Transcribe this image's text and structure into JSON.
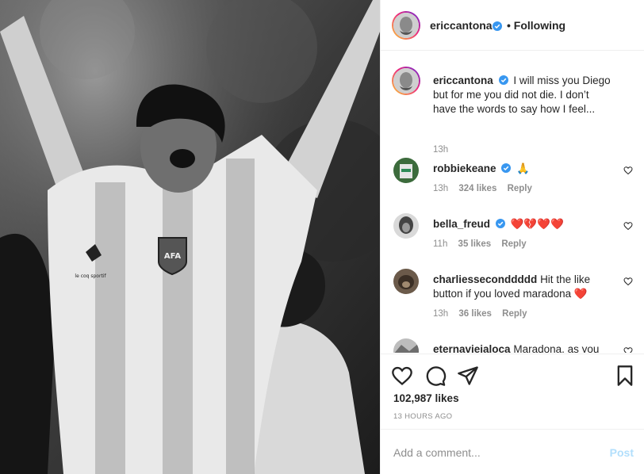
{
  "post": {
    "author": "ericcantona",
    "follow_status": "• Following",
    "caption": "I will miss you Diego but for me you did not die. I don’t have the words to say how I feel...",
    "caption_time": "13h",
    "likes": "102,987 likes",
    "time_ago": "13 HOURS AGO"
  },
  "photo": {
    "badge_text": "AFA",
    "brand_text": "le coq sportif"
  },
  "comments": [
    {
      "user": "robbiekeane",
      "text": "🙏",
      "time": "13h",
      "likes": "324 likes",
      "reply": "Reply"
    },
    {
      "user": "bella_freud",
      "text": "❤️💔❤️❤️",
      "time": "11h",
      "likes": "35 likes",
      "reply": "Reply"
    },
    {
      "user": "charliesseconddddd",
      "text": "Hit the like button if you loved maradona ❤️",
      "time": "13h",
      "likes": "36 likes",
      "reply": "Reply"
    },
    {
      "user": "eternaviejaloca",
      "text": "Maradona, as you"
    }
  ],
  "composer": {
    "placeholder": "Add a comment...",
    "post_label": "Post"
  },
  "icons": {
    "like": "heart-icon",
    "comment": "comment-icon",
    "share": "send-icon",
    "save": "bookmark-icon",
    "verified": "verified-badge-icon"
  },
  "colors": {
    "verified": "#3897f0",
    "link_disabled": "#b2dffc",
    "muted": "#8e8e8e",
    "heart_red": "#ed4956"
  }
}
